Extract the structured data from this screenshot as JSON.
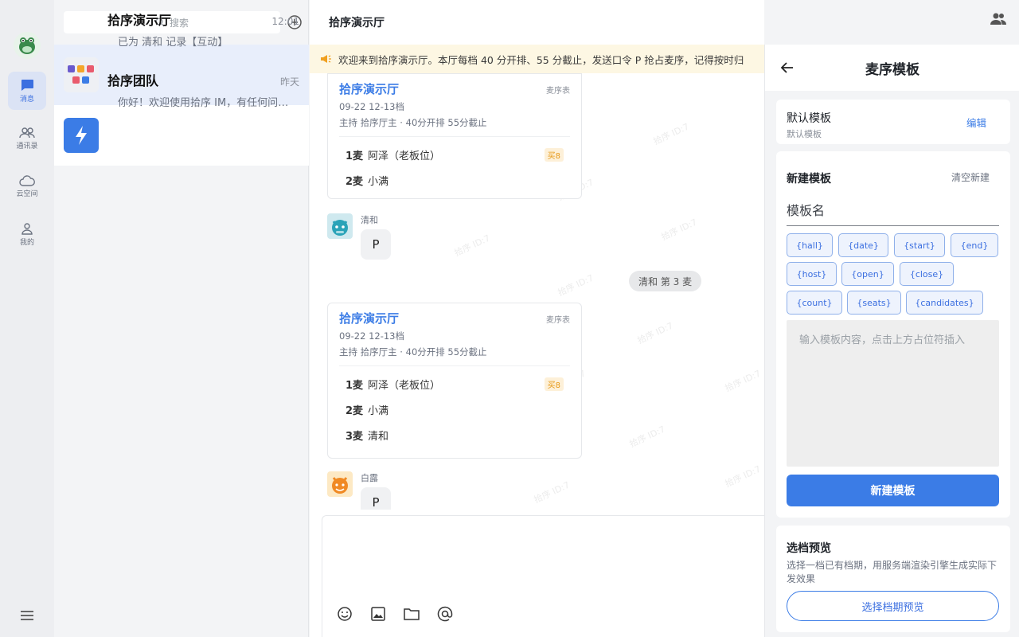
{
  "nav": {
    "items": [
      {
        "label": "消息",
        "icon": "chat-bubble-icon",
        "active": true
      },
      {
        "label": "通讯录",
        "icon": "contacts-icon",
        "active": false
      },
      {
        "label": "云空间",
        "icon": "cloud-icon",
        "active": false
      },
      {
        "label": "我的",
        "icon": "person-icon",
        "active": false
      }
    ]
  },
  "search": {
    "placeholder": "搜索"
  },
  "conversations": [
    {
      "name": "拾序演示厅",
      "time": "12:01",
      "preview": "已为 清和 记录【互动】",
      "active": true
    },
    {
      "name": "拾序团队",
      "time": "昨天",
      "preview": "你好！欢迎使用拾序 IM，有任何问题可...",
      "active": false
    }
  ],
  "chat": {
    "title": "拾序演示厅",
    "notice": "欢迎来到拾序演示厅。本厅每档 40 分开排、55 分截止，发送口令 P 抢占麦序，记得按时归",
    "watermark": "拾序 ID:7",
    "cards": [
      {
        "title": "拾序演示厅",
        "tag": "麦序表",
        "date": "09-22 12-13档",
        "host": "主持 拾序厅主 · 40分开排 55分截止",
        "seats": [
          {
            "n": "1麦",
            "name": "阿泽（老板位）",
            "badge": "买8"
          },
          {
            "n": "2麦",
            "name": "小满",
            "badge": ""
          }
        ]
      },
      {
        "title": "拾序演示厅",
        "tag": "麦序表",
        "date": "09-22 12-13档",
        "host": "主持 拾序厅主 · 40分开排 55分截止",
        "seats": [
          {
            "n": "1麦",
            "name": "阿泽（老板位）",
            "badge": "买8"
          },
          {
            "n": "2麦",
            "name": "小满",
            "badge": ""
          },
          {
            "n": "3麦",
            "name": "清和",
            "badge": ""
          }
        ]
      }
    ],
    "messages": [
      {
        "sender": "清和",
        "text": "P"
      },
      {
        "sender": "白露",
        "text": "P"
      }
    ],
    "system_pill": "清和 第 3 麦"
  },
  "panel": {
    "title": "麦序模板",
    "default_template": {
      "title": "默认模板",
      "subtitle": "默认模板",
      "edit": "编辑"
    },
    "new_template": {
      "heading": "新建模板",
      "clear": "清空新建",
      "name_placeholder": "模板名",
      "chips": [
        "{hall}",
        "{date}",
        "{start}",
        "{end}",
        "{host}",
        "{open}",
        "{close}",
        "{count}",
        "{seats}",
        "{candidates}"
      ],
      "content_placeholder": "输入模板内容，点击上方占位符插入",
      "submit": "新建模板"
    },
    "preview": {
      "heading": "选档预览",
      "desc": "选择一档已有档期，用服务端渲染引擎生成实际下发效果",
      "button": "选择档期预览"
    }
  }
}
